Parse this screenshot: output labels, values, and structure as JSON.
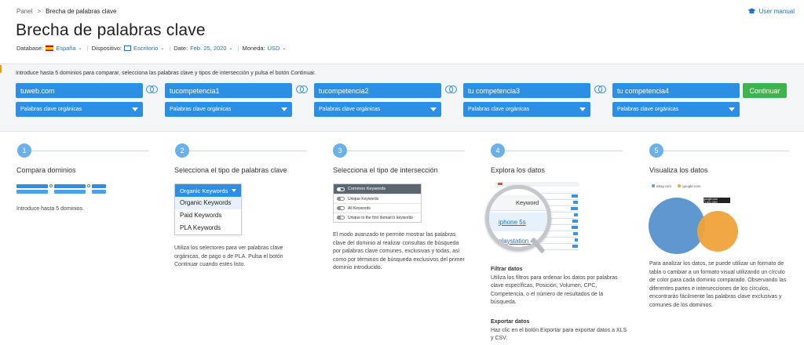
{
  "breadcrumb": {
    "root": "Panel",
    "separator": ">",
    "current": "Brecha de palabras clave"
  },
  "user_manual": "User manual",
  "title": "Brecha de palabras clave",
  "filters": {
    "database_label": "Database:",
    "database_value": "España",
    "device_label": "Dispositivo:",
    "device_value": "Escritorio",
    "date_label": "Date:",
    "date_value": "Feb. 25, 2020",
    "currency_label": "Moneda:",
    "currency_value": "USD"
  },
  "panel": {
    "instructions": "Introduce hasta 5 dominios para comparar, selecciona las palabras clave y tipos de intersección y pulsa el botón Continuar.",
    "domains": [
      "tuweb.com",
      "tucompetencia1",
      "tucompetencia2",
      "tu competencia3",
      "tu competencia4"
    ],
    "keyword_type": "Palabras clave orgánicas",
    "continue_label": "Continuar"
  },
  "steps": [
    {
      "num": "1",
      "title": "Compara dominios",
      "desc": "Introduce hasta 5 dominios."
    },
    {
      "num": "2",
      "title": "Selecciona el tipo de palabras clave",
      "desc": "Utiliza los selectores para ver palabras clave orgánicas, de pago o de PLA. Pulsa el botón Continuar cuando estés listo."
    },
    {
      "num": "3",
      "title": "Selecciona el tipo de intersección",
      "desc": "El modo avanzado te permite mostrar las palabras clave del dominio al realizar consultas de búsqueda por palabras clave comunes, exclusivas y todas, así como por términos de búsqueda exclusivos del primer dominio introducido."
    },
    {
      "num": "4",
      "title": "Explora los datos",
      "filter_heading": "Filtrar datos",
      "filter_desc": "Utiliza los filtros para ordenar los datos por palabras clave específicas, Posición, Volumen, CPC, Competencia, o el número de resultados de la búsqueda.",
      "export_heading": "Exportar datos",
      "export_desc": "Haz clic en el botón Exportar para exportar datos a XLS y CSV."
    },
    {
      "num": "5",
      "title": "Visualiza los datos",
      "desc": "Para analizar los datos, se puede utilizar un formato de tabla o cambiar a un formato visual utilizando un círculo de color para cada dominio comparado. Observando las diferentes partes e intersecciones de los círculos, encontrarás fácilmente las palabras clave exclusivas y comunes de los dominios."
    }
  ],
  "illustration_dropdown": {
    "header": "Organic Keywords",
    "items": [
      "Organic Keywords",
      "Paid Keywords",
      "PLA Keywords"
    ]
  },
  "illustration_intersection": {
    "header": "Common Keywords",
    "rows": [
      "Unique Keywords",
      "All Keywords",
      "Unique to the first domain's keywords"
    ]
  },
  "illustration_magnifier": {
    "column": "Keyword",
    "row1": "iphone 5s",
    "row2": "playstation 4"
  },
  "illustration_venn": {
    "legend_a": "ebay.com",
    "legend_b": "google.com",
    "tooltip": "google.com (1,641,262)"
  },
  "colors": {
    "accent_blue": "#2d8fe3",
    "continue_green": "#3fb34f",
    "step_circle": "#6bb0e8",
    "venn_blue": "#5f97cf",
    "venn_orange": "#f0a23a"
  }
}
